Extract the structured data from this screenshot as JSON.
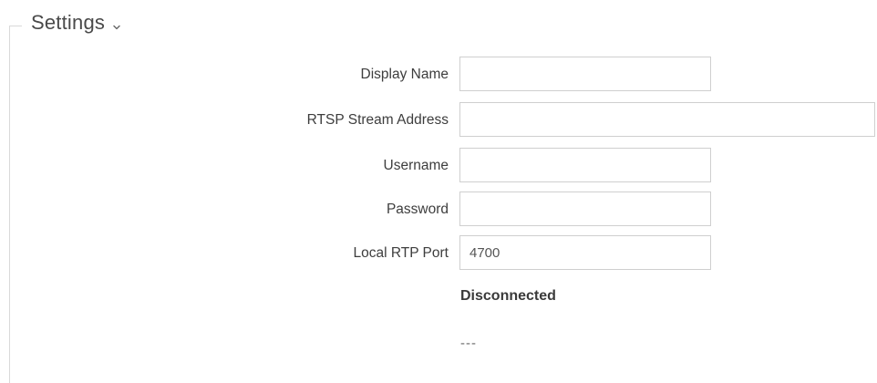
{
  "section": {
    "title": "Settings",
    "chevron_icon": "chevron-down-icon"
  },
  "fields": {
    "display_name": {
      "label": "Display Name",
      "value": ""
    },
    "rtsp_address": {
      "label": "RTSP Stream Address",
      "value": ""
    },
    "username": {
      "label": "Username",
      "value": ""
    },
    "password": {
      "label": "Password",
      "value": ""
    },
    "local_rtp_port": {
      "label": "Local RTP Port",
      "value": "4700"
    }
  },
  "status": {
    "connection": "Disconnected",
    "detail": "---"
  }
}
